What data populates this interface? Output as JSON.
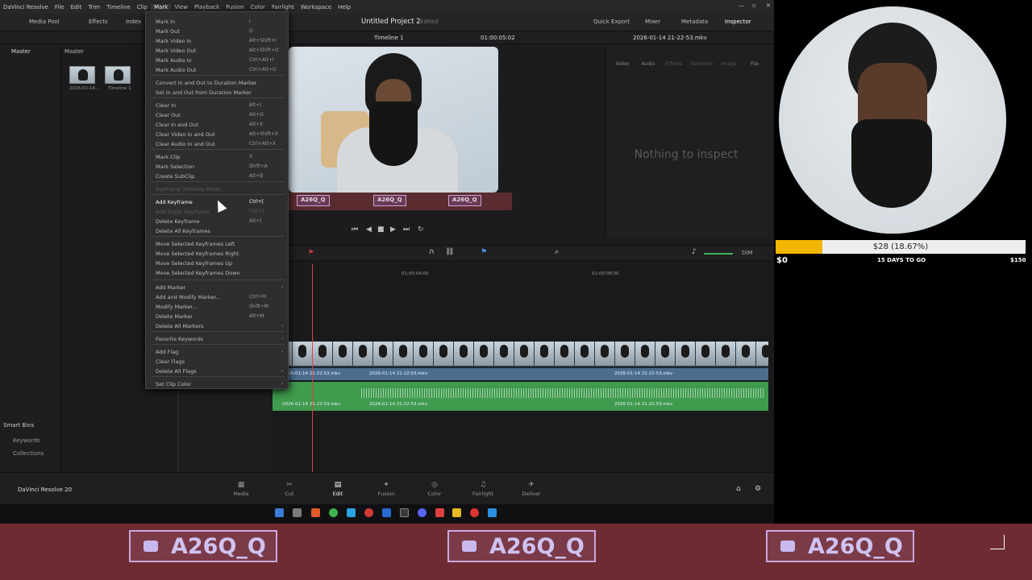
{
  "menubar": {
    "items": [
      "DaVinci Resolve",
      "File",
      "Edit",
      "Trim",
      "Timeline",
      "Clip",
      "Mark",
      "View",
      "Playback",
      "Fusion",
      "Color",
      "Fairlight",
      "Workspace",
      "Help"
    ]
  },
  "toolbar": {
    "media_pool": "Media Pool",
    "effects": "Effects",
    "index": "Index",
    "project_title": "Untitled Project 2",
    "edited": "Edited",
    "quick_export": "Quick Export",
    "mixer": "Mixer",
    "metadata": "Metadata",
    "inspector": "Inspector"
  },
  "subbar": {
    "timeline_name": "Timeline 1",
    "timecode": "01:00:05:02",
    "clip_name": "2026-01-14 21-22-53.mkv"
  },
  "mediapool": {
    "bin_master": "Master",
    "bin_header": "Master",
    "clips": [
      {
        "caption": "2026-01-14..."
      },
      {
        "caption": "Timeline 1"
      }
    ],
    "smart_bins": "Smart Bins",
    "keywords": "Keywords",
    "collections": "Collections"
  },
  "viewer": {
    "overlay_tags": [
      "A26Q_Q",
      "A26Q_Q",
      "A26Q_Q"
    ]
  },
  "inspector": {
    "tabs": [
      "Video",
      "Audio",
      "Effects",
      "Transition",
      "Image",
      "File"
    ],
    "empty": "Nothing to inspect"
  },
  "timeline": {
    "ruler": [
      "01:00:04:00",
      "01:00:08:00"
    ],
    "video_clip": "2026-01-14 21-22-53.mkv",
    "audio_clip": "2026-01-14 21-22-53.mkv",
    "dim": "DIM"
  },
  "mark_menu": {
    "items": [
      {
        "label": "Mark In",
        "shortcut": "I"
      },
      {
        "label": "Mark Out",
        "shortcut": "O"
      },
      {
        "label": "Mark Video In",
        "shortcut": "Alt+Shift+I"
      },
      {
        "label": "Mark Video Out",
        "shortcut": "Alt+Shift+O"
      },
      {
        "label": "Mark Audio In",
        "shortcut": "Ctrl+Alt+I"
      },
      {
        "label": "Mark Audio Out",
        "shortcut": "Ctrl+Alt+O"
      },
      {
        "label": "Convert In and Out to Duration Marker",
        "shortcut": ""
      },
      {
        "label": "Set In and Out from Duration Marker",
        "shortcut": ""
      },
      {
        "label": "Clear In",
        "shortcut": "Alt+I"
      },
      {
        "label": "Clear Out",
        "shortcut": "Alt+O"
      },
      {
        "label": "Clear In and Out",
        "shortcut": "Alt+X"
      },
      {
        "label": "Clear Video In and Out",
        "shortcut": "Alt+Shift+X"
      },
      {
        "label": "Clear Audio In and Out",
        "shortcut": "Ctrl+Alt+X"
      },
      {
        "label": "Mark Clip",
        "shortcut": "X"
      },
      {
        "label": "Mark Selection",
        "shortcut": "Shift+A"
      },
      {
        "label": "Create SubClip",
        "shortcut": "Alt+B"
      },
      {
        "label": "Keyframe Timeline Mode",
        "shortcut": ""
      },
      {
        "label": "Add Keyframe",
        "shortcut": "Ctrl+["
      },
      {
        "label": "Add Static Keyframe",
        "shortcut": "Ctrl+]"
      },
      {
        "label": "Delete Keyframe",
        "shortcut": "Alt+]"
      },
      {
        "label": "Delete All Keyframes",
        "shortcut": ""
      },
      {
        "label": "Move Selected Keyframes Left",
        "shortcut": ""
      },
      {
        "label": "Move Selected Keyframes Right",
        "shortcut": ""
      },
      {
        "label": "Move Selected Keyframes Up",
        "shortcut": ""
      },
      {
        "label": "Move Selected Keyframes Down",
        "shortcut": ""
      },
      {
        "label": "Add Marker",
        "shortcut": ""
      },
      {
        "label": "Add and Modify Marker...",
        "shortcut": "Ctrl+M"
      },
      {
        "label": "Modify Marker...",
        "shortcut": "Shift+M"
      },
      {
        "label": "Delete Marker",
        "shortcut": "Alt+M"
      },
      {
        "label": "Delete All Markers",
        "shortcut": ""
      },
      {
        "label": "Favorite Keywords",
        "shortcut": ""
      },
      {
        "label": "Add Flag",
        "shortcut": ""
      },
      {
        "label": "Clear Flags",
        "shortcut": ""
      },
      {
        "label": "Delete All Flags",
        "shortcut": ""
      },
      {
        "label": "Set Clip Color",
        "shortcut": ""
      }
    ]
  },
  "pages": [
    "Media",
    "Cut",
    "Edit",
    "Fusion",
    "Color",
    "Fairlight",
    "Deliver"
  ],
  "footer_app": "DaVinci Resolve 20",
  "goal": {
    "text": "$28 (18.67%)",
    "min": "$0",
    "days": "15 DAYS TO GO",
    "max": "$150",
    "progress": 0.1867
  },
  "socials": [
    {
      "icon": "youtube-icon",
      "handle": "A26Q_Q"
    },
    {
      "icon": "twitter-icon",
      "handle": "A26Q_Q"
    },
    {
      "icon": "instagram-icon",
      "handle": "A26Q_Q"
    }
  ],
  "colors": {
    "accent": "#f2b600",
    "banner": "#6e2c32",
    "audio": "#3f9b4d",
    "video": "#4b6e8f"
  }
}
